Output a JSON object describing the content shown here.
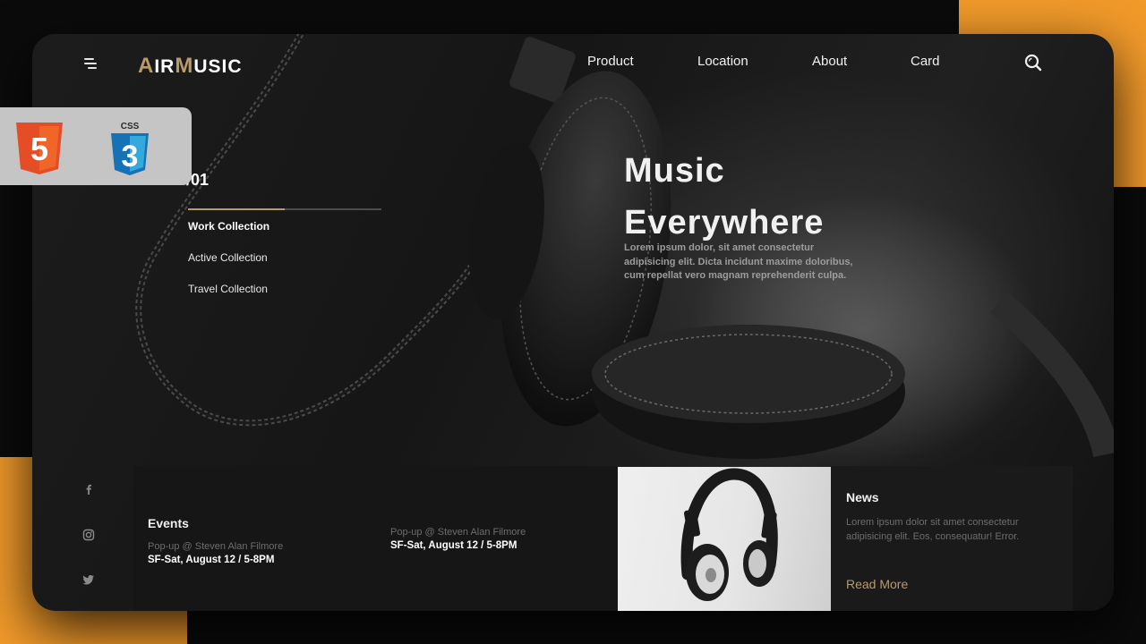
{
  "colors": {
    "accent": "#b99a6a",
    "orange": "#f19a2a",
    "html5": "#e44d26",
    "css3": "#1572b6"
  },
  "icons": {
    "menu": "menu-icon",
    "search": "search-icon",
    "facebook": "facebook-icon",
    "instagram": "instagram-icon",
    "twitter": "twitter-icon",
    "html5": "html5-logo",
    "css3": "css3-logo"
  },
  "brand": {
    "part1_accent": "A",
    "part1_rest": "IR",
    "part2_accent": "M",
    "part2_rest": "USIC"
  },
  "nav": {
    "items": [
      "Product",
      "Location",
      "About",
      "Card"
    ]
  },
  "badge": {
    "css3_label": "CSS",
    "html5_digit": "5",
    "css3_digit": "3"
  },
  "slider": {
    "counter": "/01",
    "progress": 0.5,
    "collections": [
      "Work Collection",
      "Active Collection",
      "Travel Collection"
    ]
  },
  "hero": {
    "title_line1": "Music",
    "title_line2": "Everywhere",
    "description": "Lorem ipsum dolor, sit amet consectetur adipisicing elit. Dicta incidunt maxime doloribus, cum repellat vero magnam reprehenderit culpa."
  },
  "events": {
    "title": "Events",
    "items": [
      {
        "name": "Pop-up @ Steven Alan Filmore",
        "date": "SF-Sat, August 12 / 5-8PM"
      },
      {
        "name": "Pop-up @ Steven Alan Filmore",
        "date": "SF-Sat, August 12 / 5-8PM"
      }
    ]
  },
  "news": {
    "title": "News",
    "description": "Lorem ipsum dolor sit amet consectetur adipisicing elit. Eos, consequatur! Error.",
    "read_more": "Read More"
  }
}
